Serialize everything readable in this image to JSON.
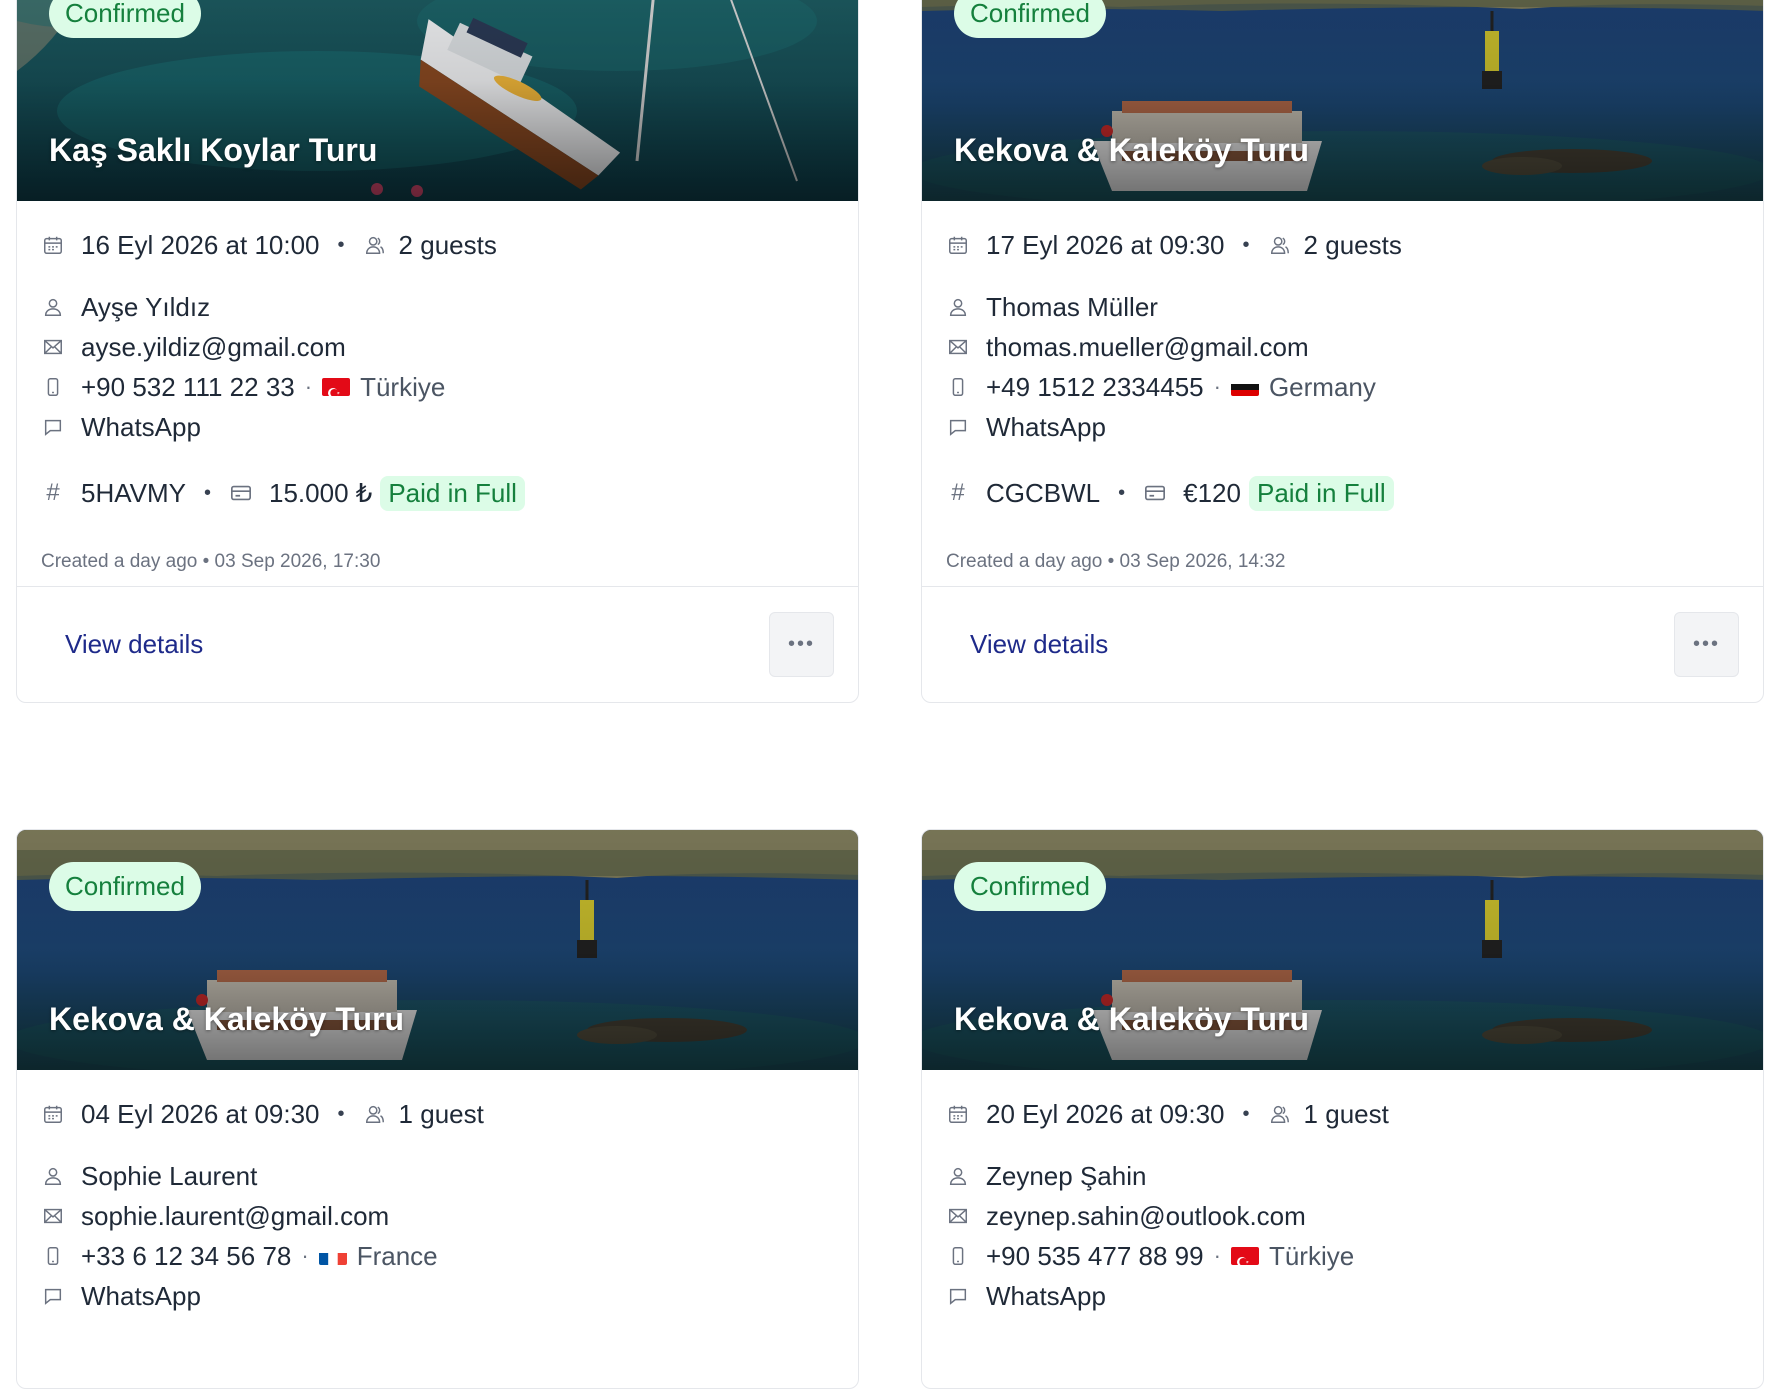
{
  "bookings": [
    {
      "status": "Confirmed",
      "tour": "Kaş Saklı Koylar Turu",
      "scene": "sailboat",
      "date": "16 Eyl 2026 at 10:00",
      "guests": "2 guests",
      "name": "Ayşe Yıldız",
      "email": "ayse.yildiz@gmail.com",
      "phone": "+90 532 111 22 33",
      "country": "Türkiye",
      "flag": "tr",
      "channel": "WhatsApp",
      "ref": "5HAVMY",
      "amount": "15.000 ₺",
      "payment_status": "Paid in Full",
      "created": "Created a day ago • 03 Sep 2026, 17:30",
      "view_label": "View details"
    },
    {
      "status": "Confirmed",
      "tour": "Kekova & Kaleköy Turu",
      "scene": "boat",
      "date": "17 Eyl 2026 at 09:30",
      "guests": "2 guests",
      "name": "Thomas Müller",
      "email": "thomas.mueller@gmail.com",
      "phone": "+49 1512 2334455",
      "country": "Germany",
      "flag": "de",
      "channel": "WhatsApp",
      "ref": "CGCBWL",
      "amount": "€120",
      "payment_status": "Paid in Full",
      "created": "Created a day ago • 03 Sep 2026, 14:32",
      "view_label": "View details"
    },
    {
      "status": "Confirmed",
      "tour": "Kekova & Kaleköy Turu",
      "scene": "boat",
      "date": "04 Eyl 2026 at 09:30",
      "guests": "1 guest",
      "name": "Sophie Laurent",
      "email": "sophie.laurent@gmail.com",
      "phone": "+33 6 12 34 56 78",
      "country": "France",
      "flag": "fr",
      "channel": "WhatsApp"
    },
    {
      "status": "Confirmed",
      "tour": "Kekova & Kaleköy Turu",
      "scene": "boat",
      "date": "20 Eyl 2026 at 09:30",
      "guests": "1 guest",
      "name": "Zeynep Şahin",
      "email": "zeynep.sahin@outlook.com",
      "phone": "+90 535 477 88 99",
      "country": "Türkiye",
      "flag": "tr",
      "channel": "WhatsApp"
    }
  ],
  "colors": {
    "badge_bg": "#dcfce7",
    "badge_text": "#15803d",
    "link": "#1e2a8a",
    "border": "#e5e7eb"
  },
  "icons": [
    "calendar-icon",
    "guests-icon",
    "user-icon",
    "mail-icon",
    "phone-icon",
    "chat-icon",
    "hash-icon",
    "card-icon",
    "more-icon"
  ]
}
